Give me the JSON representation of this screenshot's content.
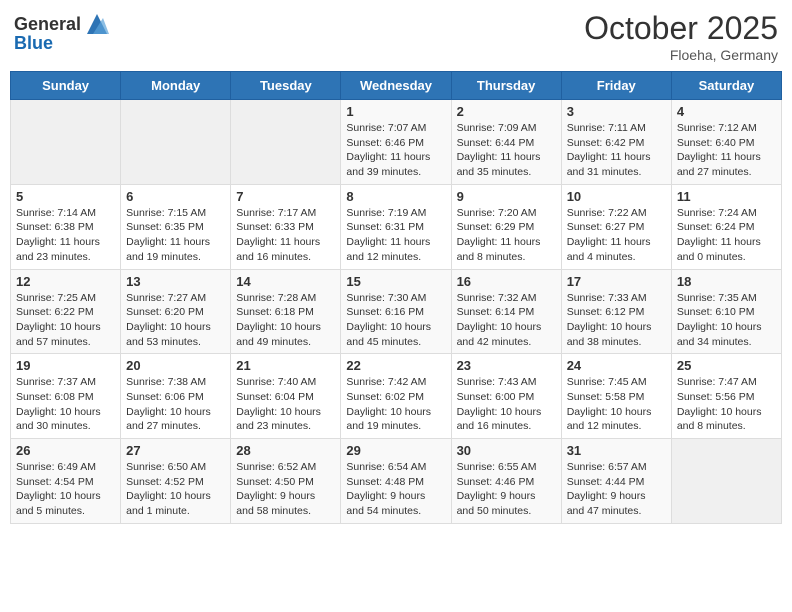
{
  "header": {
    "logo_general": "General",
    "logo_blue": "Blue",
    "month": "October 2025",
    "location": "Floeha, Germany"
  },
  "weekdays": [
    "Sunday",
    "Monday",
    "Tuesday",
    "Wednesday",
    "Thursday",
    "Friday",
    "Saturday"
  ],
  "weeks": [
    [
      {
        "day": "",
        "info": ""
      },
      {
        "day": "",
        "info": ""
      },
      {
        "day": "",
        "info": ""
      },
      {
        "day": "1",
        "info": "Sunrise: 7:07 AM\nSunset: 6:46 PM\nDaylight: 11 hours\nand 39 minutes."
      },
      {
        "day": "2",
        "info": "Sunrise: 7:09 AM\nSunset: 6:44 PM\nDaylight: 11 hours\nand 35 minutes."
      },
      {
        "day": "3",
        "info": "Sunrise: 7:11 AM\nSunset: 6:42 PM\nDaylight: 11 hours\nand 31 minutes."
      },
      {
        "day": "4",
        "info": "Sunrise: 7:12 AM\nSunset: 6:40 PM\nDaylight: 11 hours\nand 27 minutes."
      }
    ],
    [
      {
        "day": "5",
        "info": "Sunrise: 7:14 AM\nSunset: 6:38 PM\nDaylight: 11 hours\nand 23 minutes."
      },
      {
        "day": "6",
        "info": "Sunrise: 7:15 AM\nSunset: 6:35 PM\nDaylight: 11 hours\nand 19 minutes."
      },
      {
        "day": "7",
        "info": "Sunrise: 7:17 AM\nSunset: 6:33 PM\nDaylight: 11 hours\nand 16 minutes."
      },
      {
        "day": "8",
        "info": "Sunrise: 7:19 AM\nSunset: 6:31 PM\nDaylight: 11 hours\nand 12 minutes."
      },
      {
        "day": "9",
        "info": "Sunrise: 7:20 AM\nSunset: 6:29 PM\nDaylight: 11 hours\nand 8 minutes."
      },
      {
        "day": "10",
        "info": "Sunrise: 7:22 AM\nSunset: 6:27 PM\nDaylight: 11 hours\nand 4 minutes."
      },
      {
        "day": "11",
        "info": "Sunrise: 7:24 AM\nSunset: 6:24 PM\nDaylight: 11 hours\nand 0 minutes."
      }
    ],
    [
      {
        "day": "12",
        "info": "Sunrise: 7:25 AM\nSunset: 6:22 PM\nDaylight: 10 hours\nand 57 minutes."
      },
      {
        "day": "13",
        "info": "Sunrise: 7:27 AM\nSunset: 6:20 PM\nDaylight: 10 hours\nand 53 minutes."
      },
      {
        "day": "14",
        "info": "Sunrise: 7:28 AM\nSunset: 6:18 PM\nDaylight: 10 hours\nand 49 minutes."
      },
      {
        "day": "15",
        "info": "Sunrise: 7:30 AM\nSunset: 6:16 PM\nDaylight: 10 hours\nand 45 minutes."
      },
      {
        "day": "16",
        "info": "Sunrise: 7:32 AM\nSunset: 6:14 PM\nDaylight: 10 hours\nand 42 minutes."
      },
      {
        "day": "17",
        "info": "Sunrise: 7:33 AM\nSunset: 6:12 PM\nDaylight: 10 hours\nand 38 minutes."
      },
      {
        "day": "18",
        "info": "Sunrise: 7:35 AM\nSunset: 6:10 PM\nDaylight: 10 hours\nand 34 minutes."
      }
    ],
    [
      {
        "day": "19",
        "info": "Sunrise: 7:37 AM\nSunset: 6:08 PM\nDaylight: 10 hours\nand 30 minutes."
      },
      {
        "day": "20",
        "info": "Sunrise: 7:38 AM\nSunset: 6:06 PM\nDaylight: 10 hours\nand 27 minutes."
      },
      {
        "day": "21",
        "info": "Sunrise: 7:40 AM\nSunset: 6:04 PM\nDaylight: 10 hours\nand 23 minutes."
      },
      {
        "day": "22",
        "info": "Sunrise: 7:42 AM\nSunset: 6:02 PM\nDaylight: 10 hours\nand 19 minutes."
      },
      {
        "day": "23",
        "info": "Sunrise: 7:43 AM\nSunset: 6:00 PM\nDaylight: 10 hours\nand 16 minutes."
      },
      {
        "day": "24",
        "info": "Sunrise: 7:45 AM\nSunset: 5:58 PM\nDaylight: 10 hours\nand 12 minutes."
      },
      {
        "day": "25",
        "info": "Sunrise: 7:47 AM\nSunset: 5:56 PM\nDaylight: 10 hours\nand 8 minutes."
      }
    ],
    [
      {
        "day": "26",
        "info": "Sunrise: 6:49 AM\nSunset: 4:54 PM\nDaylight: 10 hours\nand 5 minutes."
      },
      {
        "day": "27",
        "info": "Sunrise: 6:50 AM\nSunset: 4:52 PM\nDaylight: 10 hours\nand 1 minute."
      },
      {
        "day": "28",
        "info": "Sunrise: 6:52 AM\nSunset: 4:50 PM\nDaylight: 9 hours\nand 58 minutes."
      },
      {
        "day": "29",
        "info": "Sunrise: 6:54 AM\nSunset: 4:48 PM\nDaylight: 9 hours\nand 54 minutes."
      },
      {
        "day": "30",
        "info": "Sunrise: 6:55 AM\nSunset: 4:46 PM\nDaylight: 9 hours\nand 50 minutes."
      },
      {
        "day": "31",
        "info": "Sunrise: 6:57 AM\nSunset: 4:44 PM\nDaylight: 9 hours\nand 47 minutes."
      },
      {
        "day": "",
        "info": ""
      }
    ]
  ]
}
